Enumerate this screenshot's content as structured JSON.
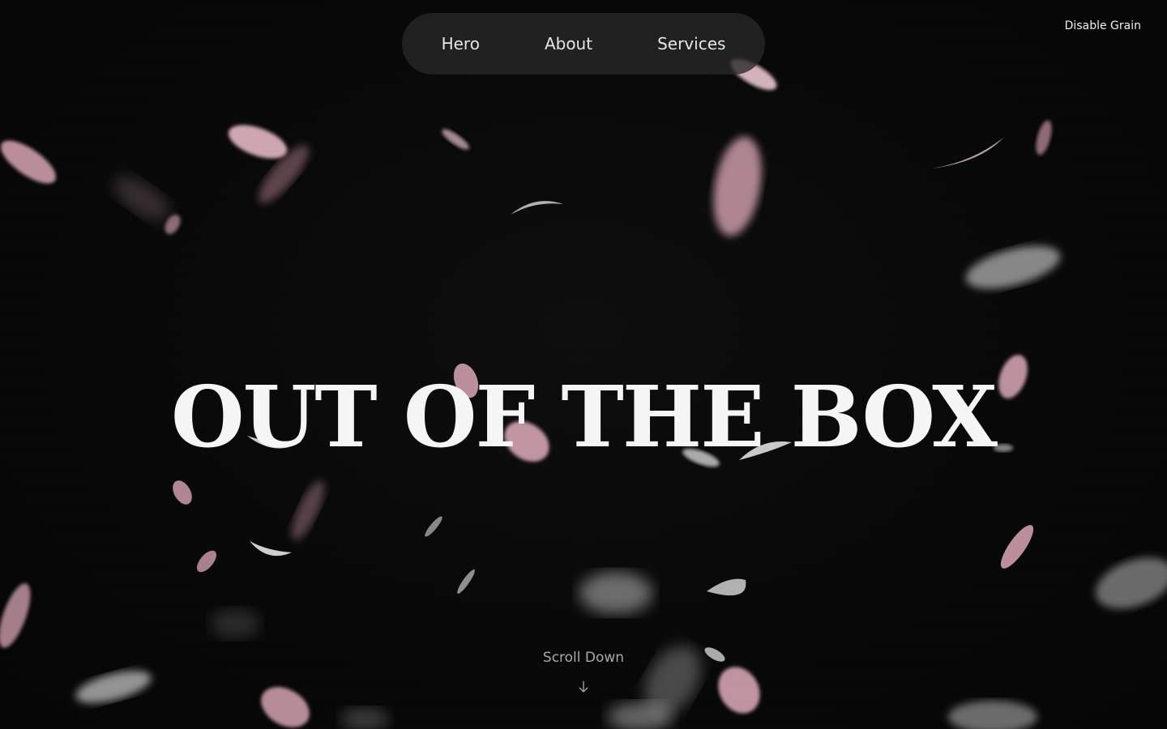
{
  "nav": {
    "items": [
      {
        "label": "Hero"
      },
      {
        "label": "About"
      },
      {
        "label": "Services"
      }
    ]
  },
  "grain_toggle": {
    "label": "Disable Grain"
  },
  "hero": {
    "headline": "OUT OF THE BOX"
  },
  "scroll_hint": {
    "label": "Scroll Down",
    "icon": "arrow-down-icon"
  },
  "colors": {
    "background": "#070707",
    "nav_background": "#282828",
    "headline": "#f5f5f5",
    "petal_pink": "#d9a6b4",
    "petal_white": "#cfcfcf"
  }
}
